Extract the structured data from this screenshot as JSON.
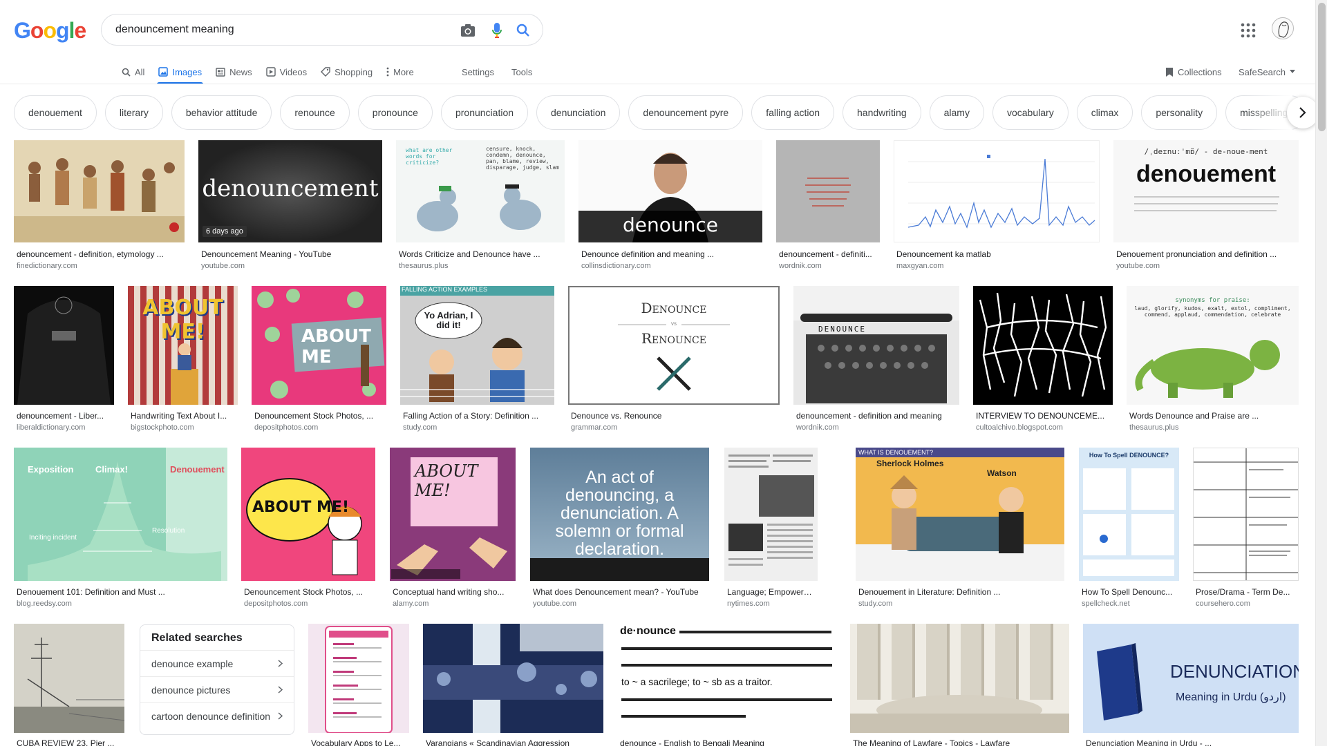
{
  "logo": {
    "text": "Google",
    "letters": [
      "G",
      "o",
      "o",
      "g",
      "l",
      "e"
    ],
    "colors": [
      "#4285F4",
      "#EA4335",
      "#FBBC05",
      "#4285F4",
      "#34A853",
      "#EA4335"
    ]
  },
  "search": {
    "query": "denouncement meaning"
  },
  "icons": {
    "camera": "camera-icon",
    "mic": "microphone-icon",
    "search": "search-icon",
    "apps": "apps-grid-icon"
  },
  "tabs": [
    {
      "label": "All",
      "icon": "search-icon"
    },
    {
      "label": "Images",
      "icon": "image-icon",
      "active": true
    },
    {
      "label": "News",
      "icon": "news-icon"
    },
    {
      "label": "Videos",
      "icon": "play-icon"
    },
    {
      "label": "Shopping",
      "icon": "tag-icon"
    },
    {
      "label": "More",
      "icon": "more-icon"
    }
  ],
  "tools": {
    "settings": "Settings",
    "tools": "Tools"
  },
  "right_tools": {
    "collections": "Collections",
    "safesearch": "SafeSearch"
  },
  "chips": [
    "denouement",
    "literary",
    "behavior attitude",
    "renounce",
    "pronounce",
    "pronunciation",
    "denunciation",
    "denouncement pyre",
    "falling action",
    "handwriting",
    "alamy",
    "vocabulary",
    "climax",
    "personality",
    "misspellings"
  ],
  "accent_color": "#1a73e8",
  "results": {
    "row1": [
      {
        "title": "denouncement - definition, etymology ...",
        "site": "finedictionary.com"
      },
      {
        "title": "Denouncement Meaning - YouTube",
        "site": "youtube.com",
        "overlay": "denouncement",
        "badge": "6 days ago"
      },
      {
        "title": "Words Criticize and Denounce have ...",
        "site": "thesaurus.plus",
        "overlay_left": "what are other words for criticize?",
        "overlay_right": "censure, knock, condemn, denounce, pan, blame, review, disparage, judge, slam"
      },
      {
        "title": "Denounce definition and meaning ...",
        "site": "collinsdictionary.com",
        "overlay": "denounce"
      },
      {
        "title": "denouncement - definiti...",
        "site": "wordnik.com"
      },
      {
        "title": "Denouncement ka matlab",
        "site": "maxgyan.com"
      },
      {
        "title": "Denouement pronunciation and definition ...",
        "site": "youtube.com",
        "overlay": "denouement",
        "overlay_sub": "/ˌdeɪnuːˈmɒ̃/ - de-noue-ment"
      }
    ],
    "row2": [
      {
        "title": "denouncement - Liber...",
        "site": "liberaldictionary.com"
      },
      {
        "title": "Handwriting Text About I...",
        "site": "bigstockphoto.com",
        "overlay": "ABOUT ME!"
      },
      {
        "title": "Denouncement Stock Photos, ...",
        "site": "depositphotos.com",
        "overlay": "ABOUT ME"
      },
      {
        "title": "Falling Action of a Story: Definition ...",
        "site": "study.com",
        "overlay": "FALLING ACTION EXAMPLES",
        "bubble": "Yo Adrian, I did it!"
      },
      {
        "title": "Denounce vs. Renounce",
        "site": "grammar.com",
        "overlay_top": "Denounce",
        "overlay_mid": "vs",
        "overlay_bottom": "Renounce"
      },
      {
        "title": "denouncement - definition and meaning",
        "site": "wordnik.com",
        "overlay": "DENOUNCE"
      },
      {
        "title": "INTERVIEW TO DENOUNCEME...",
        "site": "cultoalchivo.blogspot.com"
      },
      {
        "title": "Words Denounce and Praise are ...",
        "site": "thesaurus.plus",
        "overlay": "synonyms for praise:",
        "overlay_sub": "laud, glorify, kudos, exalt, extol, compliment, commend, applaud, commendation, celebrate"
      }
    ],
    "row3": [
      {
        "title": "Denouement 101: Definition and Must ...",
        "site": "blog.reedsy.com",
        "labels": [
          "Exposition",
          "Climax!",
          "Denouement",
          "Inciting incident",
          "Resolution"
        ]
      },
      {
        "title": "Denouncement Stock Photos, ...",
        "site": "depositphotos.com",
        "overlay": "ABOUT ME!"
      },
      {
        "title": "Conceptual hand writing sho...",
        "site": "alamy.com",
        "overlay": "ABOUT ME!"
      },
      {
        "title": "What does Denouncement mean? - YouTube",
        "site": "youtube.com",
        "overlay": "An act of denouncing, a denunciation. A solemn or formal declaration."
      },
      {
        "title": "Language; Empowerment ...",
        "site": "nytimes.com"
      },
      {
        "title": "Denouement in Literature: Definition ...",
        "site": "study.com",
        "overlay_top": "WHAT IS DENOUEMENT?",
        "label_left": "Sherlock Holmes",
        "label_right": "Watson"
      },
      {
        "title": "How To Spell Denounc...",
        "site": "spellcheck.net",
        "overlay": "How To Spell DENOUNCE?"
      },
      {
        "title": "Prose/Drama - Term De...",
        "site": "coursehero.com"
      }
    ],
    "row4": [
      {
        "title": "CUBA REVIEW 23, Pier ...",
        "site": ""
      },
      {
        "title": "Vocabulary Apps to Le...",
        "site": ""
      },
      {
        "title": "Varangians « Scandinavian Aggression",
        "site": ""
      },
      {
        "title": "denounce - English to Bengali Meaning",
        "site": "",
        "overlay_word": "de·nounce",
        "overlay_text": "to ~ a sacrilege; to ~ sb as a traitor."
      },
      {
        "title": "The Meaning of Lawfare - Topics - Lawfare",
        "site": ""
      },
      {
        "title": "Denunciation Meaning in Urdu - ...",
        "site": "",
        "overlay": "DENUNCIATION",
        "overlay_sub": "Meaning in Urdu (اردو)"
      }
    ]
  },
  "related": {
    "heading": "Related searches",
    "items": [
      "denounce example",
      "denounce pictures",
      "cartoon denounce definition"
    ]
  }
}
